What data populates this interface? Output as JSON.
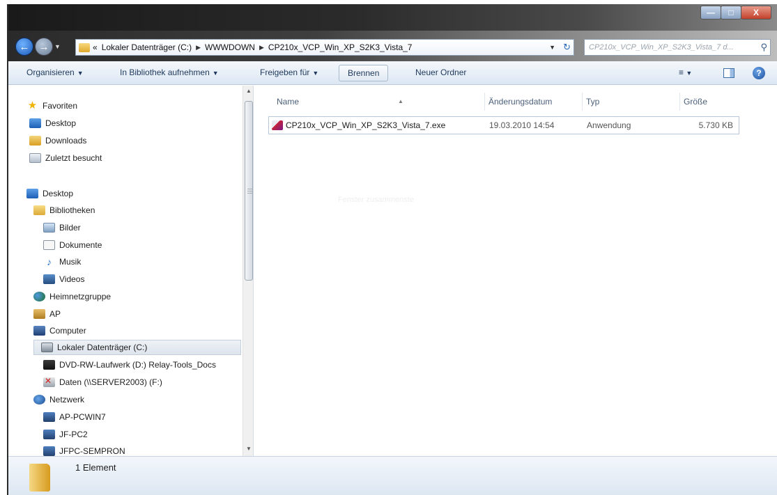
{
  "window": {
    "buttons": {
      "minimize": "—",
      "maximize": "□",
      "close": "X"
    }
  },
  "addressbar": {
    "overflow": "«",
    "crumbs": [
      "Lokaler Datenträger (C:)",
      "WWWDOWN",
      "CP210x_VCP_Win_XP_S2K3_Vista_7"
    ],
    "separator": "▶"
  },
  "search": {
    "placeholder": "CP210x_VCP_Win_XP_S2K3_Vista_7 d..."
  },
  "toolbar": {
    "organize": "Organisieren",
    "include_library": "In Bibliothek aufnehmen",
    "share": "Freigeben für",
    "burn": "Brennen",
    "new_folder": "Neuer Ordner",
    "help": "?"
  },
  "navigation": {
    "favorites": "Favoriten",
    "desktop": "Desktop",
    "downloads": "Downloads",
    "recent": "Zuletzt besucht",
    "desktop_root": "Desktop",
    "libraries": "Bibliotheken",
    "pictures": "Bilder",
    "documents": "Dokumente",
    "music": "Musik",
    "videos": "Videos",
    "homegroup": "Heimnetzgruppe",
    "user": "AP",
    "computer": "Computer",
    "drive_c": "Lokaler Datenträger (C:)",
    "drive_d": "DVD-RW-Laufwerk (D:) Relay-Tools_Docs",
    "drive_f": "Daten (\\\\SERVER2003) (F:)",
    "network": "Netzwerk",
    "pc1": "AP-PCWIN7",
    "pc2": "JF-PC2",
    "pc3": "JFPC-SEMPRON"
  },
  "columns": {
    "name": "Name",
    "date": "Änderungsdatum",
    "type": "Typ",
    "size": "Größe"
  },
  "files": [
    {
      "name": "CP210x_VCP_Win_XP_S2K3_Vista_7.exe",
      "date": "19.03.2010 14:54",
      "type": "Anwendung",
      "size": "5.730 KB"
    }
  ],
  "content": {
    "faint_text": "Fenster zusammenste"
  },
  "status": {
    "count": "1 Element"
  }
}
